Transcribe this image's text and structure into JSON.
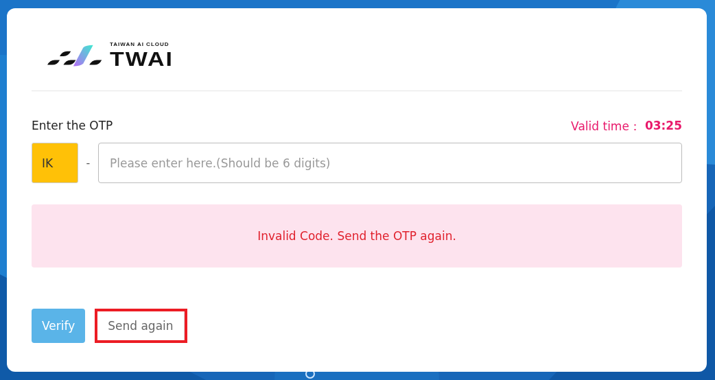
{
  "logo": {
    "tagline": "TAIWAN AI CLOUD",
    "wordmark": "TWAI"
  },
  "otp": {
    "label": "Enter the OTP",
    "valid_label": "Valid time：",
    "valid_time": "03:25",
    "prefix": "IK",
    "separator": "-",
    "placeholder": "Please enter here.(Should be 6 digits)"
  },
  "alert": {
    "message": "Invalid Code. Send the OTP again."
  },
  "buttons": [
    {
      "kind": "primary",
      "label": "Verify",
      "highlighted": false
    },
    {
      "kind": "plain",
      "label": "Send again",
      "highlighted": true
    }
  ]
}
